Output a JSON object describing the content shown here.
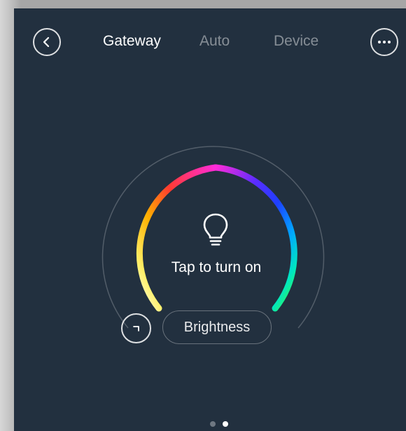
{
  "header": {
    "back_icon": "chevron-left-icon",
    "more_icon": "more-horizontal-icon",
    "tabs": [
      {
        "label": "Gateway",
        "active": true
      },
      {
        "label": "Auto",
        "active": false
      },
      {
        "label": "Device",
        "active": false
      }
    ]
  },
  "main": {
    "status_text": "Tap to turn on",
    "bulb_icon": "light-bulb-icon",
    "brightness_label": "Brightness",
    "mode_icon": "corner-icon",
    "power_state": "off"
  },
  "pager": {
    "current": 2,
    "total": 2
  },
  "colors": {
    "background": "#22303f",
    "tab_active": "#ffffff",
    "tab_inactive": "#8d96a1",
    "ring_gradient": [
      "#fff7b0",
      "#ffd54a",
      "#ff4b2b",
      "#ff2bd8",
      "#6b2bff",
      "#1f3cff",
      "#00a8ff",
      "#00ffa6",
      "#33ff33"
    ]
  }
}
